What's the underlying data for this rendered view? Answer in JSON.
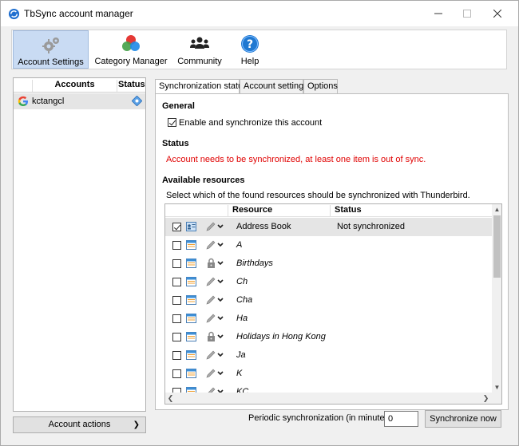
{
  "window": {
    "title": "TbSync account manager"
  },
  "toolbar": {
    "items": [
      {
        "label": "Account Settings",
        "icon": "gear-icon",
        "active": true
      },
      {
        "label": "Category Manager",
        "icon": "color-circles-icon"
      },
      {
        "label": "Community",
        "icon": "people-icon"
      },
      {
        "label": "Help",
        "icon": "help-icon"
      }
    ]
  },
  "accounts": {
    "col_accounts": "Accounts",
    "col_status": "Status",
    "items": [
      {
        "name": "kctangcl",
        "provider_icon": "google-icon",
        "status_icon": "sync-status-icon"
      }
    ],
    "actions_label": "Account actions"
  },
  "tabs": {
    "sync": "Synchronization status",
    "account": "Account settings",
    "options": "Options"
  },
  "general": {
    "title": "General",
    "enable_label": "Enable and synchronize this account",
    "enable_checked": true
  },
  "status": {
    "title": "Status",
    "message": "Account needs to be synchronized, at least one item is out of sync.",
    "message_color": "#e00000"
  },
  "resources": {
    "title": "Available resources",
    "hint": "Select which of the found resources should be synchronized with Thunderbird.",
    "col_resource": "Resource",
    "col_status": "Status",
    "rows": [
      {
        "name": "Address Book",
        "status": "Not synchronized",
        "checked": true,
        "type": "addressbook",
        "locked": false,
        "italic": false
      },
      {
        "name": "A",
        "status": "",
        "checked": false,
        "type": "calendar",
        "locked": false,
        "italic": true
      },
      {
        "name": "Birthdays",
        "status": "",
        "checked": false,
        "type": "calendar",
        "locked": true,
        "italic": true
      },
      {
        "name": "Ch",
        "status": "",
        "checked": false,
        "type": "calendar",
        "locked": false,
        "italic": true
      },
      {
        "name": "Cha",
        "status": "",
        "checked": false,
        "type": "calendar",
        "locked": false,
        "italic": true
      },
      {
        "name": "Ha",
        "status": "",
        "checked": false,
        "type": "calendar",
        "locked": false,
        "italic": true
      },
      {
        "name": "Holidays in Hong Kong",
        "status": "",
        "checked": false,
        "type": "calendar",
        "locked": true,
        "italic": true
      },
      {
        "name": "Ja",
        "status": "",
        "checked": false,
        "type": "calendar",
        "locked": false,
        "italic": true
      },
      {
        "name": "K",
        "status": "",
        "checked": false,
        "type": "calendar",
        "locked": false,
        "italic": true
      },
      {
        "name": "KC",
        "status": "",
        "checked": false,
        "type": "calendar",
        "locked": false,
        "italic": true
      }
    ]
  },
  "footer": {
    "periodic_label": "Periodic synchronization (in minutes)",
    "periodic_value": "0",
    "sync_now_label": "Synchronize now"
  }
}
